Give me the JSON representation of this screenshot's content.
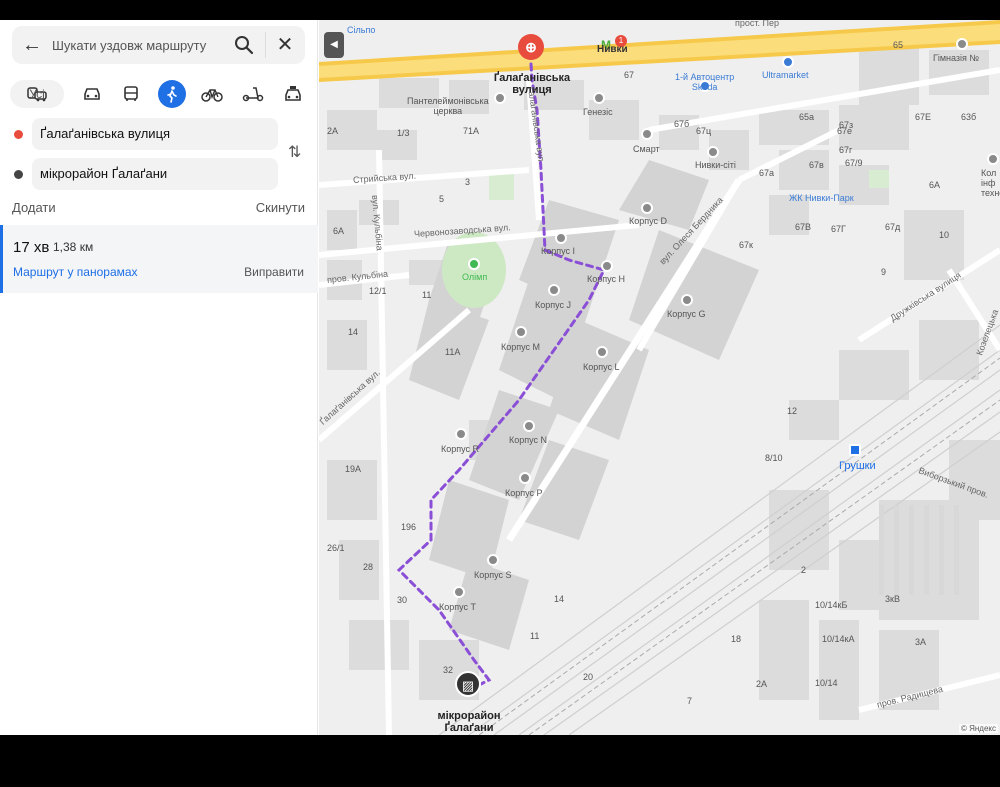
{
  "search": {
    "placeholder": "Шукати уздовж маршруту"
  },
  "modes": {
    "all_label": "Усі",
    "items": [
      "car-icon",
      "bus-icon",
      "walk-icon",
      "bicycle-icon",
      "scooter-icon",
      "taxi-icon"
    ],
    "active": "walk-icon"
  },
  "route_points": {
    "from": "Ґалаґанівська вулиця",
    "to": "мікрорайон Ґалаґани",
    "from_color": "#e84c3d",
    "to_color": "#444444"
  },
  "actions": {
    "add": "Додати",
    "reset": "Скинути"
  },
  "route": {
    "time": "17 хв",
    "distance": "1,38 км",
    "panorama_link": "Маршрут у панорамах",
    "fix_link": "Виправити"
  },
  "map": {
    "start_label": "Ґалаґанівська\nвулиця",
    "end_label": "мікрорайон\nҐалаґани",
    "route_color": "#8a4fd6",
    "accent_blue": "#1f6fe5",
    "streets": {
      "prospect": "прост. Пер",
      "striiska": "Стрийська вул.",
      "chervonozavodska": "Червонозаводська вул.",
      "kulbina_st": "вул. Кульбіна",
      "kulbina_lane": "пров. Кульбіна",
      "galaganivska": "Ґалаґанівська вул.",
      "berdnyka": "вул. Олеся Бердника",
      "druzhkivska": "Дружківська вулиця",
      "vyborzka_lane": "Виборзький пров.",
      "radishcheva": "пров. Радищева",
      "zavodska_vert": "Заваліжна вул.",
      "kozeletska": "Козелецька"
    },
    "places": {
      "silpo": "Сільпо",
      "nyvky": "Нивки",
      "pantel_church": "Пантелеймонівська\nцерква",
      "genezis": "Генезіс",
      "smart": "Смарт",
      "nyvky_city": "Нивки-сіті",
      "autocenter": "1-й Автоцентр\nSkoda",
      "ultramarket": "Ultramarket",
      "gymnasium": "Гімназія №",
      "zhk_nyvky_park": "ЖК Нивки-Парк",
      "colledge": "Кол\nінф\nтехно",
      "olimp": "Олімп",
      "grushky": "Грушки",
      "korpus_d": "Корпус D",
      "korpus_i": "Корпус I",
      "korpus_h": "Корпус H",
      "korpus_j": "Корпус J",
      "korpus_g": "Корпус G",
      "korpus_m": "Корпус M",
      "korpus_l": "Корпус L",
      "korpus_r": "Корпус R",
      "korpus_n": "Корпус N",
      "korpus_p": "Корпус P",
      "korpus_s": "Корпус S",
      "korpus_t": "Корпус T",
      "galaganivska_vert": "Ґалаґанівська вул"
    },
    "house_numbers": [
      "65",
      "67",
      "67б",
      "67в",
      "67а",
      "67е",
      "67г",
      "67к",
      "65а",
      "67ц",
      "67/9",
      "6А",
      "10",
      "9",
      "2А",
      "1/3",
      "71А",
      "3",
      "5",
      "6А",
      "12/1",
      "11",
      "11А",
      "14",
      "19А",
      "196",
      "26/1",
      "28",
      "30",
      "32",
      "12",
      "8/10",
      "14",
      "11",
      "18",
      "20",
      "10/14кБ",
      "10/14кА",
      "10/14",
      "3кВ",
      "3А",
      "2А",
      "7",
      "2",
      "67з",
      "63б",
      "67Е",
      "67д",
      "67В",
      "67Г",
      "1",
      "3",
      "4"
    ],
    "metro_count": "1",
    "copyright": "© Яндекс"
  }
}
